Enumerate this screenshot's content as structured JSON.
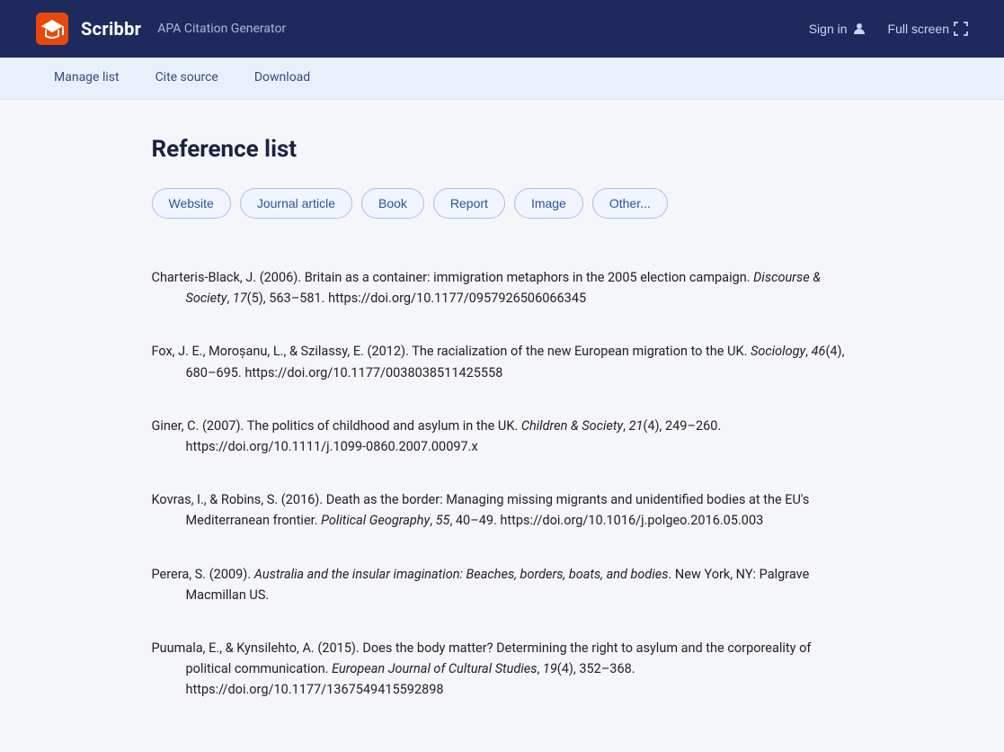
{
  "header": {
    "logo_name": "Scribbr",
    "subtitle": "APA Citation Generator",
    "sign_in_label": "Sign in",
    "fullscreen_label": "Full screen"
  },
  "nav": {
    "items": [
      {
        "id": "manage-list",
        "label": "Manage list",
        "active": false
      },
      {
        "id": "cite-source",
        "label": "Cite source",
        "active": false
      },
      {
        "id": "download",
        "label": "Download",
        "active": false
      }
    ]
  },
  "main": {
    "title": "Reference list",
    "source_types": [
      {
        "id": "website",
        "label": "Website"
      },
      {
        "id": "journal-article",
        "label": "Journal article"
      },
      {
        "id": "book",
        "label": "Book"
      },
      {
        "id": "report",
        "label": "Report"
      },
      {
        "id": "image",
        "label": "Image"
      },
      {
        "id": "other",
        "label": "Other..."
      }
    ],
    "references": [
      {
        "id": "ref1",
        "text_html": "Charteris-Black, J. (2006). Britain as a container: immigration metaphors in the 2005 election campaign. <em>Discourse &amp; Society</em>, <em>17</em>(5), 563–581. https://doi.org/10.1177/0957926506066345"
      },
      {
        "id": "ref2",
        "text_html": "Fox, J. E., Moroșanu, L., &amp; Szilassy, E. (2012). The racialization of the new European migration to the UK. <em>Sociology</em>, <em>46</em>(4), 680–695. https://doi.org/10.1177/0038038511425558"
      },
      {
        "id": "ref3",
        "text_html": "Giner, C. (2007). The politics of childhood and asylum in the UK. <em>Children &amp; Society</em>, <em>21</em>(4), 249–260. https://doi.org/10.1111/j.1099-0860.2007.00097.x"
      },
      {
        "id": "ref4",
        "text_html": "Kovras, I., &amp; Robins, S. (2016). Death as the border: Managing missing migrants and unidentified bodies at the EU's Mediterranean frontier. <em>Political Geography</em>, <em>55</em>, 40–49. https://doi.org/10.1016/j.polgeo.2016.05.003"
      },
      {
        "id": "ref5",
        "text_html": "Perera, S. (2009). <em>Australia and the insular imagination: Beaches, borders, boats, and bodies</em>. New York, NY: Palgrave Macmillan US."
      },
      {
        "id": "ref6",
        "text_html": "Puumala, E., &amp; Kynsilehto, A. (2015). Does the body matter? Determining the right to asylum and the corporeality of political communication. <em>European Journal of Cultural Studies</em>, <em>19</em>(4), 352–368. https://doi.org/10.1177/1367549415592898"
      }
    ]
  }
}
